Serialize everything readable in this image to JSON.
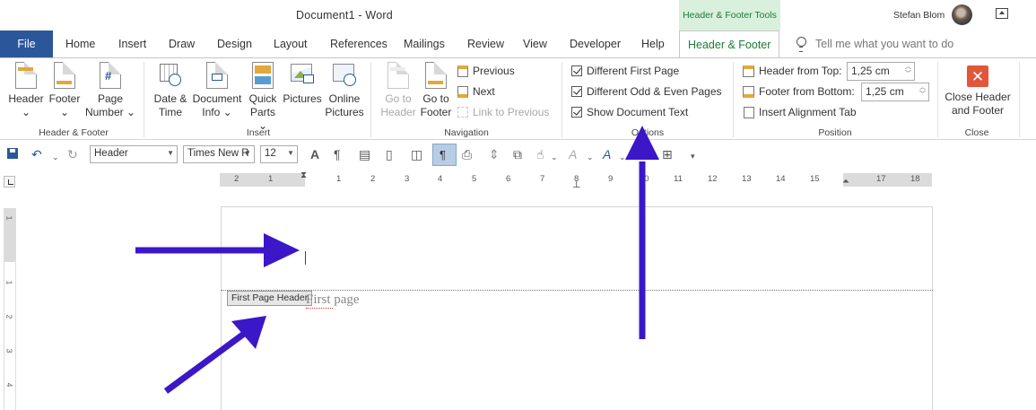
{
  "titlebar": {
    "document_title": "Document1  -  Word",
    "context_group": "Header & Footer Tools",
    "user_name": "Stefan Blom"
  },
  "tabs": {
    "file": "File",
    "items": [
      "Home",
      "Insert",
      "Draw",
      "Design",
      "Layout",
      "References",
      "Mailings",
      "Review",
      "View",
      "Developer",
      "Help"
    ],
    "active": "Header & Footer",
    "tell_me": "Tell me what you want to do"
  },
  "ribbon": {
    "header_footer_group": {
      "label": "Header & Footer",
      "header": "Header",
      "footer": "Footer",
      "page_number_line1": "Page",
      "page_number_line2": "Number"
    },
    "insert_group": {
      "label": "Insert",
      "date_time_line1": "Date &",
      "date_time_line2": "Time",
      "document_info_line1": "Document",
      "document_info_line2": "Info",
      "quick_parts_line1": "Quick",
      "quick_parts_line2": "Parts",
      "pictures": "Pictures",
      "online_pictures_line1": "Online",
      "online_pictures_line2": "Pictures"
    },
    "navigation_group": {
      "label": "Navigation",
      "goto_header_line1": "Go to",
      "goto_header_line2": "Header",
      "goto_footer_line1": "Go to",
      "goto_footer_line2": "Footer",
      "previous": "Previous",
      "next": "Next",
      "link_to_previous": "Link to Previous"
    },
    "options_group": {
      "label": "Options",
      "different_first_page": "Different First Page",
      "different_odd_even": "Different Odd & Even Pages",
      "show_document_text": "Show Document Text",
      "different_first_page_checked": true,
      "different_odd_even_checked": true,
      "show_document_text_checked": true
    },
    "position_group": {
      "label": "Position",
      "header_from_top": "Header from Top:",
      "header_from_top_value": "1,25 cm",
      "footer_from_bottom": "Footer from Bottom:",
      "footer_from_bottom_value": "1,25 cm",
      "insert_alignment_tab": "Insert Alignment Tab"
    },
    "close_group": {
      "label": "Close",
      "close_line1": "Close Header",
      "close_line2": "and Footer"
    }
  },
  "qat": {
    "style_value": "Header",
    "font_value": "Times New R",
    "size_value": "12"
  },
  "ruler": {
    "numbers": [
      "2",
      "1",
      "1",
      "2",
      "3",
      "4",
      "5",
      "6",
      "7",
      "8",
      "9",
      "10",
      "11",
      "12",
      "13",
      "14",
      "15",
      "17",
      "18"
    ],
    "vertical_numbers": [
      "1",
      "1",
      "2",
      "3",
      "4"
    ]
  },
  "document": {
    "header_tag": "First Page Header",
    "body_text": "First page"
  },
  "annotations": {
    "arrow_color": "#3b17c8"
  }
}
